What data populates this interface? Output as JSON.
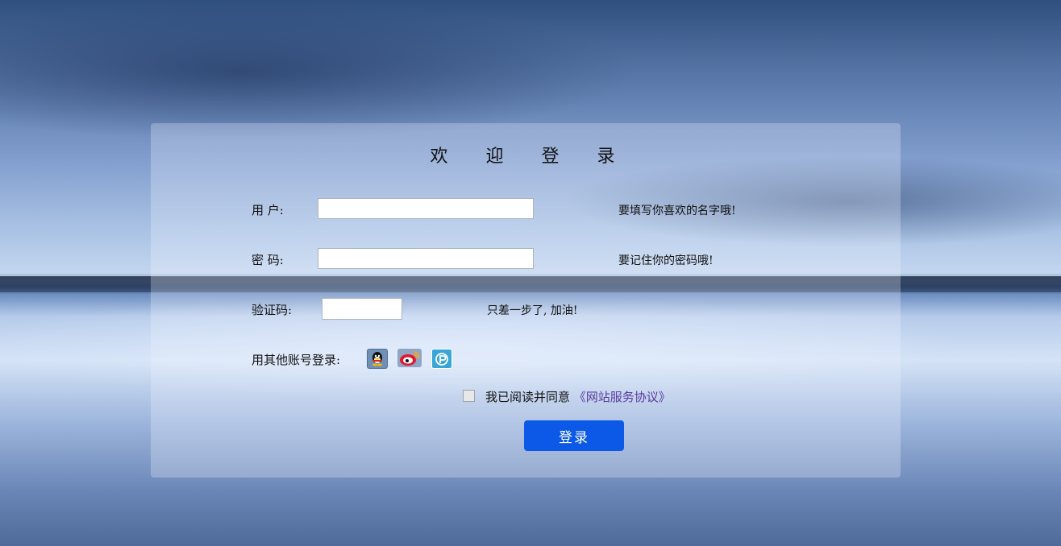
{
  "title": "欢 迎 登 录",
  "username": {
    "label": "用 户:",
    "value": "",
    "placeholder": "",
    "hint": "要填写你喜欢的名字哦!"
  },
  "password": {
    "label": "密 码:",
    "value": "",
    "placeholder": "",
    "hint": "要记住你的密码哦!"
  },
  "captcha": {
    "label": "验证码:",
    "value": "",
    "placeholder": "",
    "hint": "只差一步了, 加油!"
  },
  "social": {
    "label": "用其他账号登录:",
    "icons": [
      "qq-icon",
      "weibo-icon",
      "pp-icon"
    ]
  },
  "agreement": {
    "text": "我已阅读并同意",
    "link": "《网站服务协议》",
    "checked": false
  },
  "login_button": "登录",
  "colors": {
    "button": "#0c59e8",
    "link": "#5a3aa0"
  }
}
